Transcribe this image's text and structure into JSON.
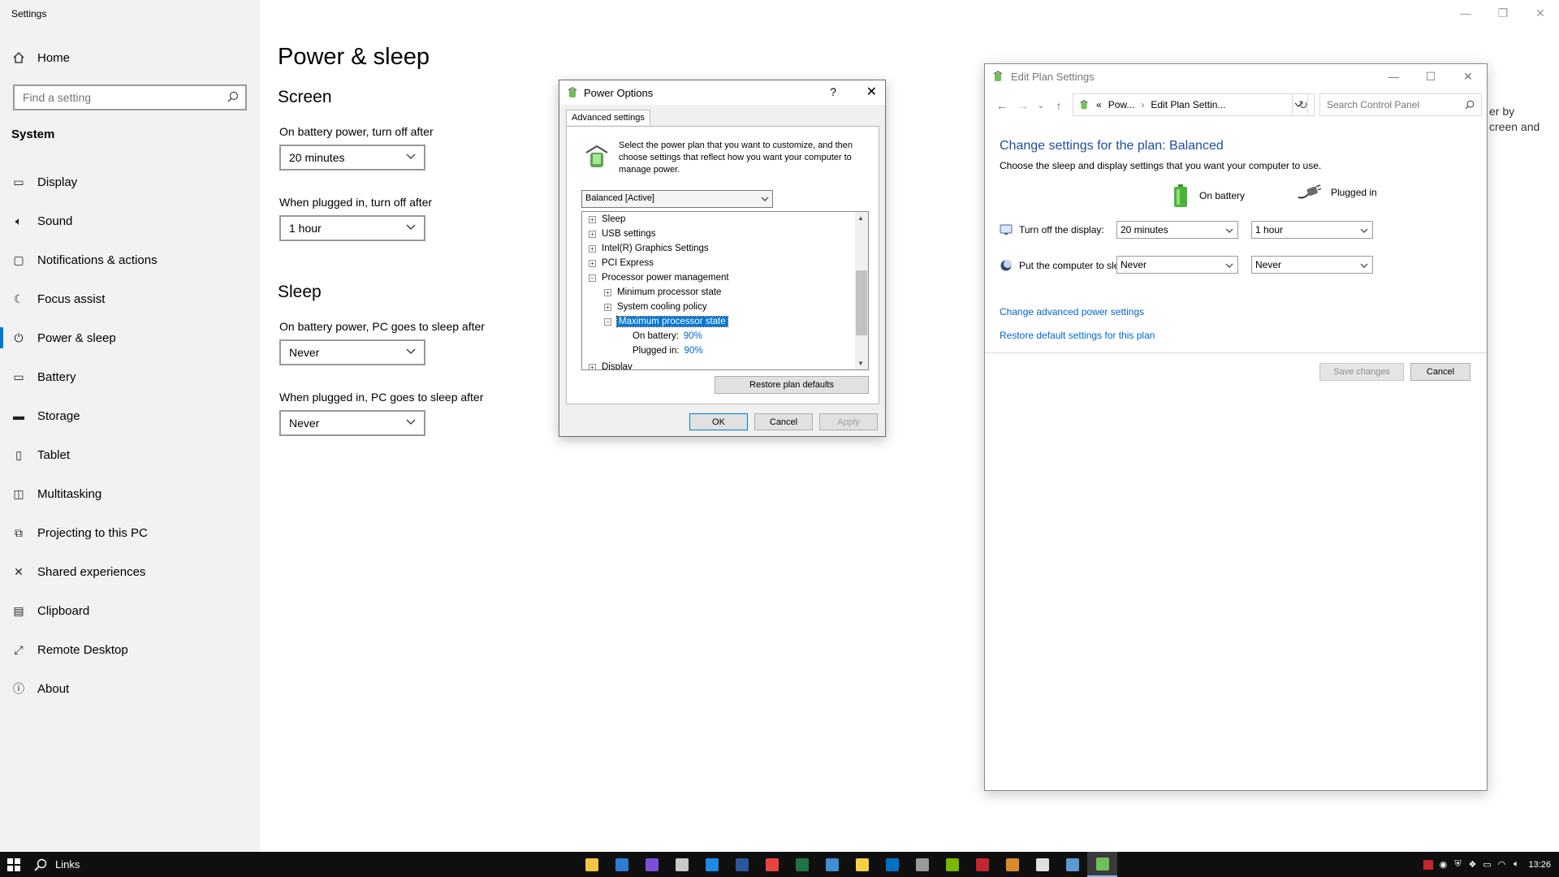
{
  "settings": {
    "app_title": "Settings",
    "home_label": "Home",
    "search_placeholder": "Find a setting",
    "section_heading": "System",
    "nav_items": [
      {
        "label": "Display",
        "icon": "monitor-icon"
      },
      {
        "label": "Sound",
        "icon": "speaker-icon"
      },
      {
        "label": "Notifications & actions",
        "icon": "message-icon"
      },
      {
        "label": "Focus assist",
        "icon": "moon-icon"
      },
      {
        "label": "Power & sleep",
        "icon": "power-icon"
      },
      {
        "label": "Battery",
        "icon": "battery-icon"
      },
      {
        "label": "Storage",
        "icon": "storage-icon"
      },
      {
        "label": "Tablet",
        "icon": "tablet-icon"
      },
      {
        "label": "Multitasking",
        "icon": "multitasking-icon"
      },
      {
        "label": "Projecting to this PC",
        "icon": "projecting-icon"
      },
      {
        "label": "Shared experiences",
        "icon": "shared-icon"
      },
      {
        "label": "Clipboard",
        "icon": "clipboard-icon"
      },
      {
        "label": "Remote Desktop",
        "icon": "remote-icon"
      },
      {
        "label": "About",
        "icon": "info-icon"
      }
    ],
    "active_item": "Power & sleep",
    "page_title": "Power & sleep",
    "screen_section": "Screen",
    "screen_battery_label": "On battery power, turn off after",
    "screen_battery_value": "20 minutes",
    "screen_plugged_label": "When plugged in, turn off after",
    "screen_plugged_value": "1 hour",
    "sleep_section": "Sleep",
    "sleep_battery_label": "On battery power, PC goes to sleep after",
    "sleep_battery_value": "Never",
    "sleep_plugged_label": "When plugged in, PC goes to sleep after",
    "sleep_plugged_value": "Never",
    "bg_fragment_line1": "er by",
    "bg_fragment_line2": "creen and"
  },
  "power_dialog": {
    "title": "Power Options",
    "help_label": "?",
    "tab_label": "Advanced settings",
    "description": "Select the power plan that you want to customize, and then choose settings that reflect how you want your computer to manage power.",
    "plan_selected": "Balanced [Active]",
    "tree_items": [
      {
        "label": "Sleep"
      },
      {
        "label": "USB settings"
      },
      {
        "label": "Intel(R) Graphics Settings"
      },
      {
        "label": "PCI Express"
      },
      {
        "label": "Processor power management"
      },
      {
        "label": "Minimum processor state"
      },
      {
        "label": "System cooling policy"
      },
      {
        "label": "Maximum processor state"
      },
      {
        "label": "On battery:",
        "value": "90%"
      },
      {
        "label": "Plugged in:",
        "value": "90%"
      },
      {
        "label": "Display"
      }
    ],
    "restore_label": "Restore plan defaults",
    "ok_label": "OK",
    "cancel_label": "Cancel",
    "apply_label": "Apply"
  },
  "edit_plan": {
    "title": "Edit Plan Settings",
    "crumb_1": "Pow...",
    "crumb_2": "Edit Plan Settin...",
    "crumb_prefix": "«",
    "search_placeholder": "Search Control Panel",
    "heading": "Change settings for the plan: Balanced",
    "subheading": "Choose the sleep and display settings that you want your computer to use.",
    "col_battery": "On battery",
    "col_plugged": "Plugged in",
    "display_label": "Turn off the display:",
    "display_battery": "20 minutes",
    "display_plugged": "1 hour",
    "sleep_label": "Put the computer to sleep:",
    "sleep_battery": "Never",
    "sleep_plugged": "Never",
    "link_advanced": "Change advanced power settings",
    "link_restore": "Restore default settings for this plan",
    "save_label": "Save changes",
    "cancel_label": "Cancel"
  },
  "taskbar": {
    "search_label": "Links",
    "clock": "13:26",
    "apps": [
      {
        "icon": "file-explorer-icon",
        "color": "#f4c542"
      },
      {
        "icon": "remote-connection-icon",
        "color": "#2d7dd2"
      },
      {
        "icon": "firefox-icon",
        "color": "#7b4fd6"
      },
      {
        "icon": "steam-icon",
        "color": "#c9c9c9"
      },
      {
        "icon": "dropbox-icon",
        "color": "#1e88e5"
      },
      {
        "icon": "word-icon",
        "color": "#2b579a"
      },
      {
        "icon": "chrome-icon",
        "color": "#e8453c"
      },
      {
        "icon": "excel-icon",
        "color": "#217346"
      },
      {
        "icon": "this-pc-icon",
        "color": "#3d8fd6"
      },
      {
        "icon": "notes-icon",
        "color": "#f7d046"
      },
      {
        "icon": "outlook-icon",
        "color": "#0072c6"
      },
      {
        "icon": "terminal-icon",
        "color": "#9a9a9a"
      },
      {
        "icon": "nvidia-icon",
        "color": "#76b900"
      },
      {
        "icon": "acrobat-icon",
        "color": "#c1272d"
      },
      {
        "icon": "game-icon",
        "color": "#d98b2b"
      },
      {
        "icon": "settings-gear-icon",
        "color": "#e0e0e0"
      },
      {
        "icon": "control-panel-icon",
        "color": "#5a9bd4"
      },
      {
        "icon": "power-options-icon",
        "color": "#6fbf5a"
      }
    ],
    "active_app": "power-options-icon"
  },
  "colors": {
    "accent": "#0078d7",
    "link": "#0066cc",
    "heading_blue": "#1e4fa0",
    "sidebar_bg": "#f2f2f2",
    "taskbar_bg": "#0f0f10"
  }
}
